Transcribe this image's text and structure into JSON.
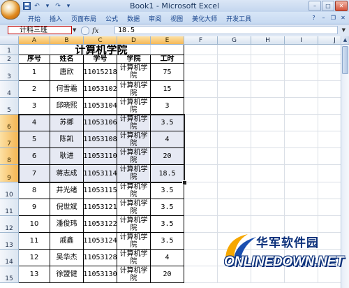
{
  "window": {
    "title": "Book1 - Microsoft Excel",
    "buttons": [
      "–",
      "□",
      "✕"
    ]
  },
  "quick_access": [
    "save-icon",
    "undo-icon",
    "redo-icon",
    "customize-icon"
  ],
  "ribbon": {
    "tabs": [
      "开始",
      "插入",
      "页面布局",
      "公式",
      "数据",
      "审阅",
      "视图",
      "美化大师",
      "开发工具"
    ]
  },
  "formula_bar": {
    "name_box": "计料三班",
    "fx": "fx",
    "content": "18.5"
  },
  "grid": {
    "columns": [
      "A",
      "B",
      "C",
      "D",
      "E",
      "F",
      "G",
      "H",
      "I",
      "J"
    ],
    "selected_columns": [
      "A",
      "B",
      "C",
      "D",
      "E"
    ],
    "rows": [
      "1",
      "2",
      "3",
      "4",
      "5",
      "6",
      "7",
      "8",
      "9",
      "10",
      "11",
      "12",
      "13",
      "14",
      "15"
    ],
    "selected_rows": [
      "6",
      "7",
      "8",
      "9"
    ],
    "title": "计算机学院",
    "headers": [
      "序号",
      "姓名",
      "学号",
      "学院",
      "工时"
    ],
    "data": [
      [
        "1",
        "唐欣",
        "11015218",
        "计算机学院",
        "75"
      ],
      [
        "2",
        "何雪霜",
        "11053102",
        "计算机学院",
        "15"
      ],
      [
        "3",
        "邱晓熙",
        "11053104",
        "计算机学院",
        "3"
      ],
      [
        "4",
        "苏娜",
        "11053106",
        "计算机学院",
        "3.5"
      ],
      [
        "5",
        "陈凯",
        "11053108",
        "计算机学院",
        "4"
      ],
      [
        "6",
        "耿进",
        "11053110",
        "计算机学院",
        "20"
      ],
      [
        "7",
        "蒋志成",
        "11053114",
        "计算机学院",
        "18.5"
      ],
      [
        "8",
        "井光绪",
        "11053115",
        "计算机学院",
        "3.5"
      ],
      [
        "9",
        "倪世斌",
        "11053121",
        "计算机学院",
        "3.5"
      ],
      [
        "10",
        "潘俊玮",
        "11053122",
        "计算机学院",
        "3.5"
      ],
      [
        "11",
        "戚鑫",
        "11053124",
        "计算机学院",
        "3.5"
      ],
      [
        "12",
        "吴华杰",
        "11053128",
        "计算机学院",
        "4"
      ],
      [
        "13",
        "徐盟健",
        "11053130",
        "计算机学院",
        "20"
      ]
    ]
  },
  "watermark": {
    "cn": "华军软件园",
    "en": "ONLINEDOWN.NET"
  }
}
